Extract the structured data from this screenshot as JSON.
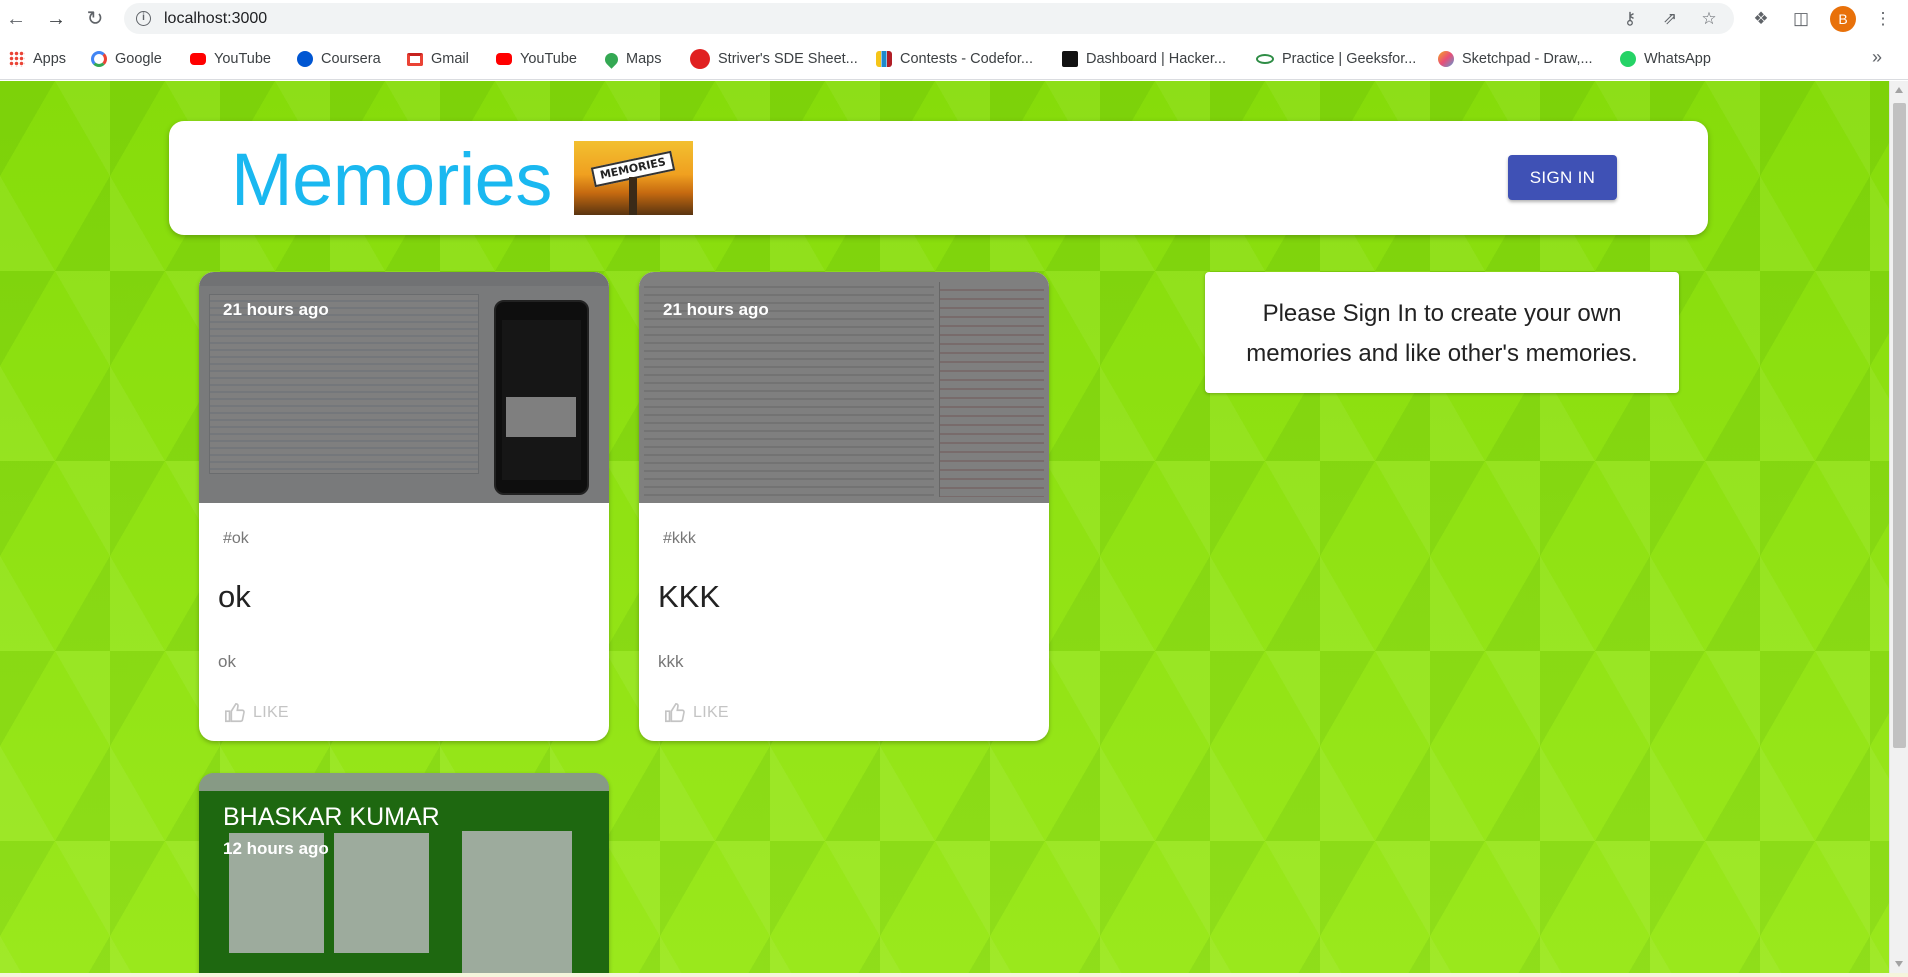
{
  "browser": {
    "url": "localhost:3000",
    "profile_initial": "B",
    "nav_icons": [
      "back-arrow-icon",
      "forward-arrow-icon",
      "reload-icon"
    ],
    "bookmarks": [
      {
        "label": "Apps",
        "icon": "apps-grid-icon",
        "color": "#4285f4"
      },
      {
        "label": "Google",
        "icon": "google-icon",
        "color": "#4285f4"
      },
      {
        "label": "YouTube",
        "icon": "youtube-icon",
        "color": "#ff0000"
      },
      {
        "label": "Coursera",
        "icon": "coursera-icon",
        "color": "#0056d2"
      },
      {
        "label": "Gmail",
        "icon": "gmail-icon",
        "color": "#ea4335"
      },
      {
        "label": "YouTube",
        "icon": "youtube-icon",
        "color": "#ff0000"
      },
      {
        "label": "Maps",
        "icon": "maps-icon",
        "color": "#34a853"
      },
      {
        "label": "Striver's SDE Sheet...",
        "icon": "tuf-icon",
        "color": "#e02020"
      },
      {
        "label": "Contests - Codefor...",
        "icon": "codeforces-icon",
        "color": "#1f8acb"
      },
      {
        "label": "Dashboard | Hacker...",
        "icon": "hackerrank-icon",
        "color": "#111111"
      },
      {
        "label": "Practice | Geeksfor...",
        "icon": "geeksforgeeks-icon",
        "color": "#2f8d46"
      },
      {
        "label": "Sketchpad - Draw,...",
        "icon": "sketchpad-icon",
        "color": "#f5a623"
      },
      {
        "label": "WhatsApp",
        "icon": "whatsapp-icon",
        "color": "#25d366"
      }
    ]
  },
  "app": {
    "brand": "Memories",
    "brand_image_text": "MEMORIES",
    "sign_in_label": "SIGN IN",
    "info_message": "Please Sign In to create your own memories and like other's memories."
  },
  "posts": [
    {
      "creator": "",
      "time": "21 hours ago",
      "tags": "#ok",
      "title": "ok",
      "message": "ok",
      "like_label": "LIKE"
    },
    {
      "creator": "",
      "time": "21 hours ago",
      "tags": "#kkk",
      "title": "KKK",
      "message": "kkk",
      "like_label": "LIKE"
    },
    {
      "creator": "BHASKAR KUMAR",
      "time": "12 hours ago",
      "tags": "",
      "title": "",
      "message": "",
      "like_label": ""
    }
  ],
  "colors": {
    "brand": "#1ab8f0",
    "sign_in": "#3f51b5",
    "background": "#8fe016"
  }
}
